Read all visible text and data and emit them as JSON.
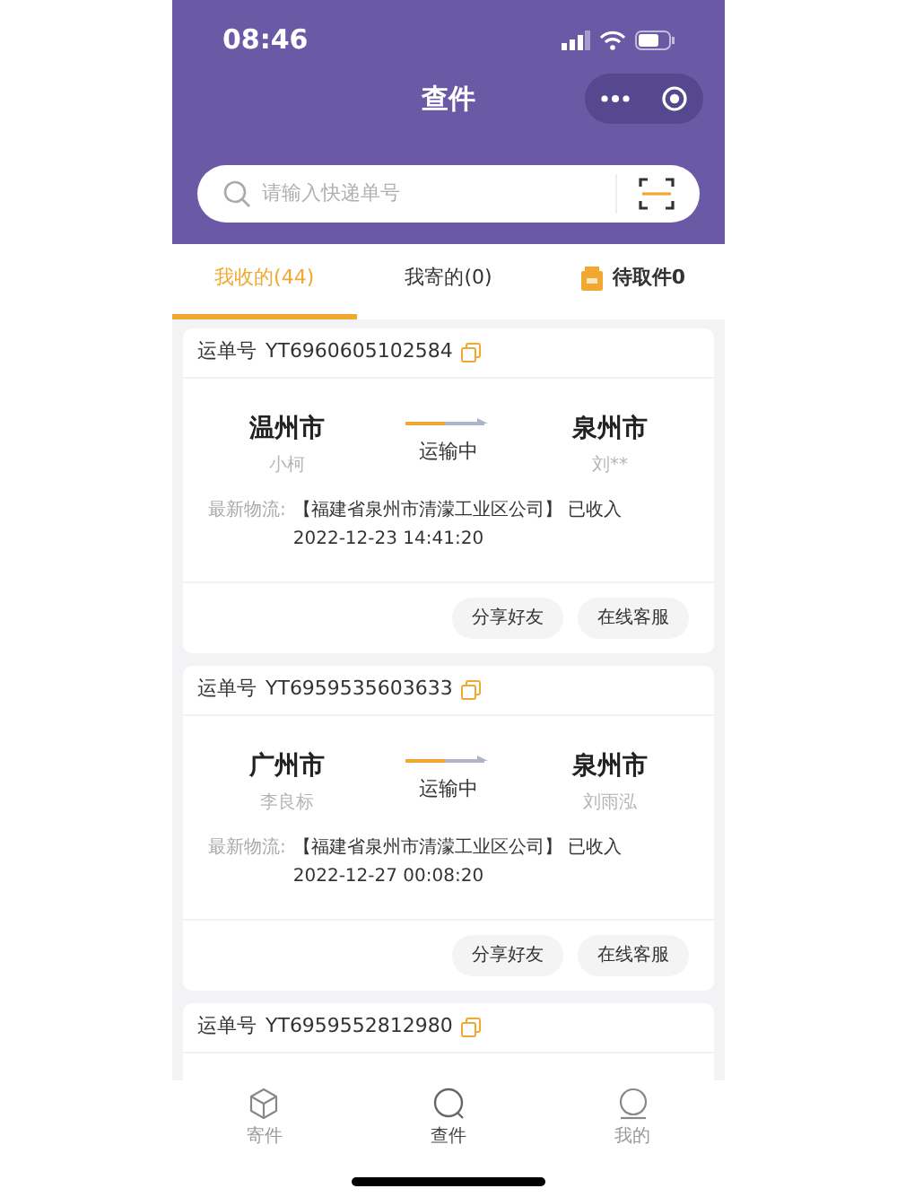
{
  "status_bar": {
    "time": "08:46"
  },
  "header": {
    "title": "查件"
  },
  "search": {
    "placeholder": "请输入快递单号"
  },
  "tabs": [
    {
      "label": "我收的(44)",
      "selected": true,
      "kind": "text"
    },
    {
      "label": "我寄的(0)",
      "selected": false,
      "kind": "text"
    },
    {
      "label": "待取件0",
      "selected": false,
      "kind": "icon"
    }
  ],
  "shipments": [
    {
      "waybill_label": "运单号",
      "waybill": "YT6960605102584",
      "from_city": "温州市",
      "sender": "小柯",
      "status": "运输中",
      "to_city": "泉州市",
      "recipient": "刘**",
      "logistics_label": "最新物流:",
      "logistics": "【福建省泉州市清濛工业区公司】 已收入",
      "time": "2022-12-23 14:41:20",
      "buttons": [
        "分享好友",
        "在线客服"
      ]
    },
    {
      "waybill_label": "运单号",
      "waybill": "YT6959535603633",
      "from_city": "广州市",
      "sender": "李良标",
      "status": "运输中",
      "to_city": "泉州市",
      "recipient": "刘雨泓",
      "logistics_label": "最新物流:",
      "logistics": "【福建省泉州市清濛工业区公司】 已收入",
      "time": "2022-12-27 00:08:20",
      "buttons": [
        "分享好友",
        "在线客服"
      ]
    },
    {
      "waybill_label": "运单号",
      "waybill": "YT6959552812980"
    }
  ],
  "bottom_nav": [
    {
      "label": "寄件",
      "selected": false,
      "kind": "box"
    },
    {
      "label": "查件",
      "selected": true,
      "kind": "search"
    },
    {
      "label": "我的",
      "selected": false,
      "kind": "profile"
    }
  ]
}
